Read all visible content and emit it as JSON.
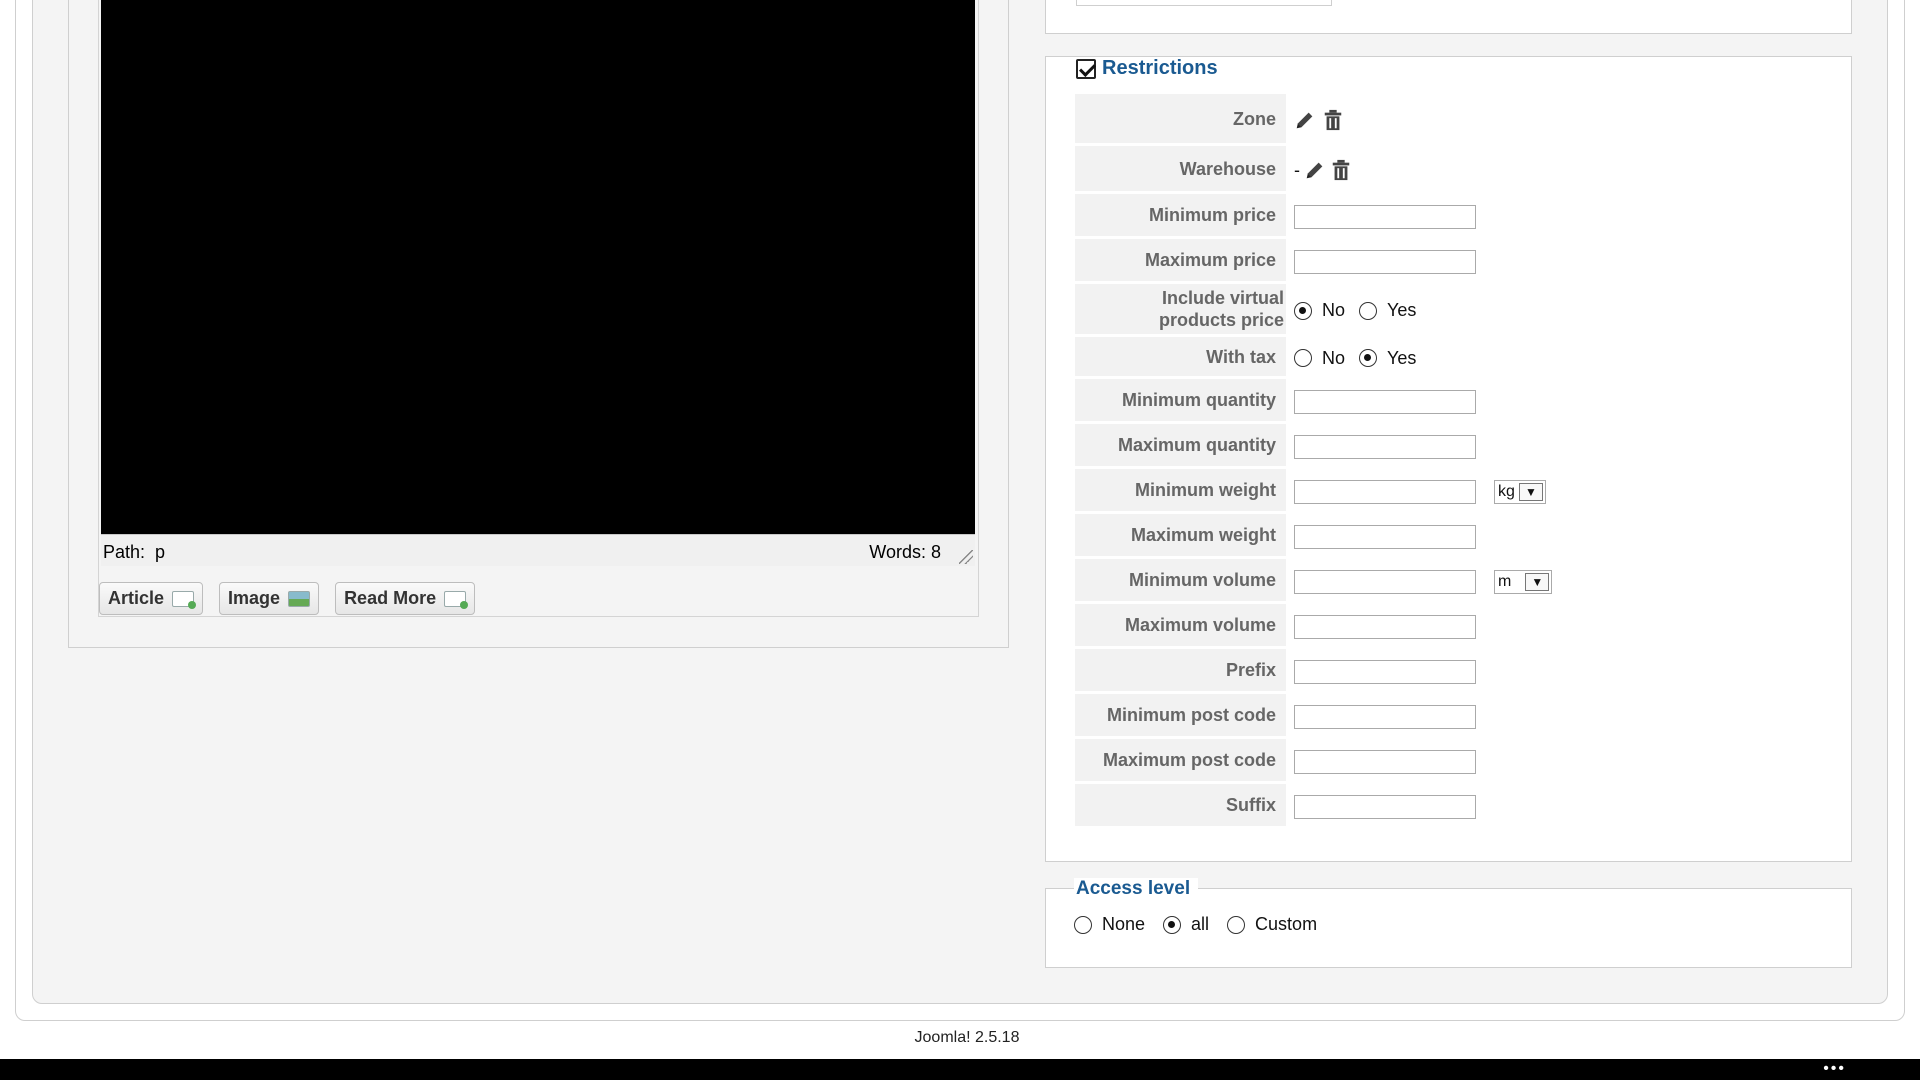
{
  "editor": {
    "path_label": "Path:",
    "path_value": "p",
    "words_label": "Words: 8",
    "buttons": [
      {
        "label": "Article",
        "icon": "article-add-icon"
      },
      {
        "label": "Image",
        "icon": "image-icon"
      },
      {
        "label": "Read More",
        "icon": "readmore-add-icon"
      }
    ]
  },
  "restrictions": {
    "title": "Restrictions",
    "enabled": true,
    "rows": {
      "zone": {
        "label": "Zone"
      },
      "warehouse": {
        "label": "Warehouse",
        "value": "-"
      },
      "min_price": {
        "label": "Minimum price",
        "value": ""
      },
      "max_price": {
        "label": "Maximum price",
        "value": ""
      },
      "include_virtual": {
        "label_line1": "Include virtual",
        "label_line2": "products price",
        "opt_no": "No",
        "opt_yes": "Yes",
        "selected": "No"
      },
      "with_tax": {
        "label": "With tax",
        "opt_no": "No",
        "opt_yes": "Yes",
        "selected": "Yes"
      },
      "min_quantity": {
        "label": "Minimum quantity",
        "value": ""
      },
      "max_quantity": {
        "label": "Maximum quantity",
        "value": ""
      },
      "min_weight": {
        "label": "Minimum weight",
        "value": "",
        "unit": "kg"
      },
      "max_weight": {
        "label": "Maximum weight",
        "value": ""
      },
      "min_volume": {
        "label": "Minimum volume",
        "value": "",
        "unit": "m"
      },
      "max_volume": {
        "label": "Maximum volume",
        "value": ""
      },
      "prefix": {
        "label": "Prefix",
        "value": ""
      },
      "min_post_code": {
        "label": "Minimum post code",
        "value": ""
      },
      "max_post_code": {
        "label": "Maximum post code",
        "value": ""
      },
      "suffix": {
        "label": "Suffix",
        "value": ""
      }
    }
  },
  "access_level": {
    "title": "Access level",
    "opt_none": "None",
    "opt_all": "all",
    "opt_custom": "Custom",
    "selected": "all"
  },
  "footer": {
    "version": "Joomla! 2.5.18"
  },
  "taskbar": {
    "menu_dots": "•••"
  },
  "colors": {
    "legend": "#1a5a91",
    "label_gray": "#666666",
    "panel_bg": "#f4f4f4"
  }
}
